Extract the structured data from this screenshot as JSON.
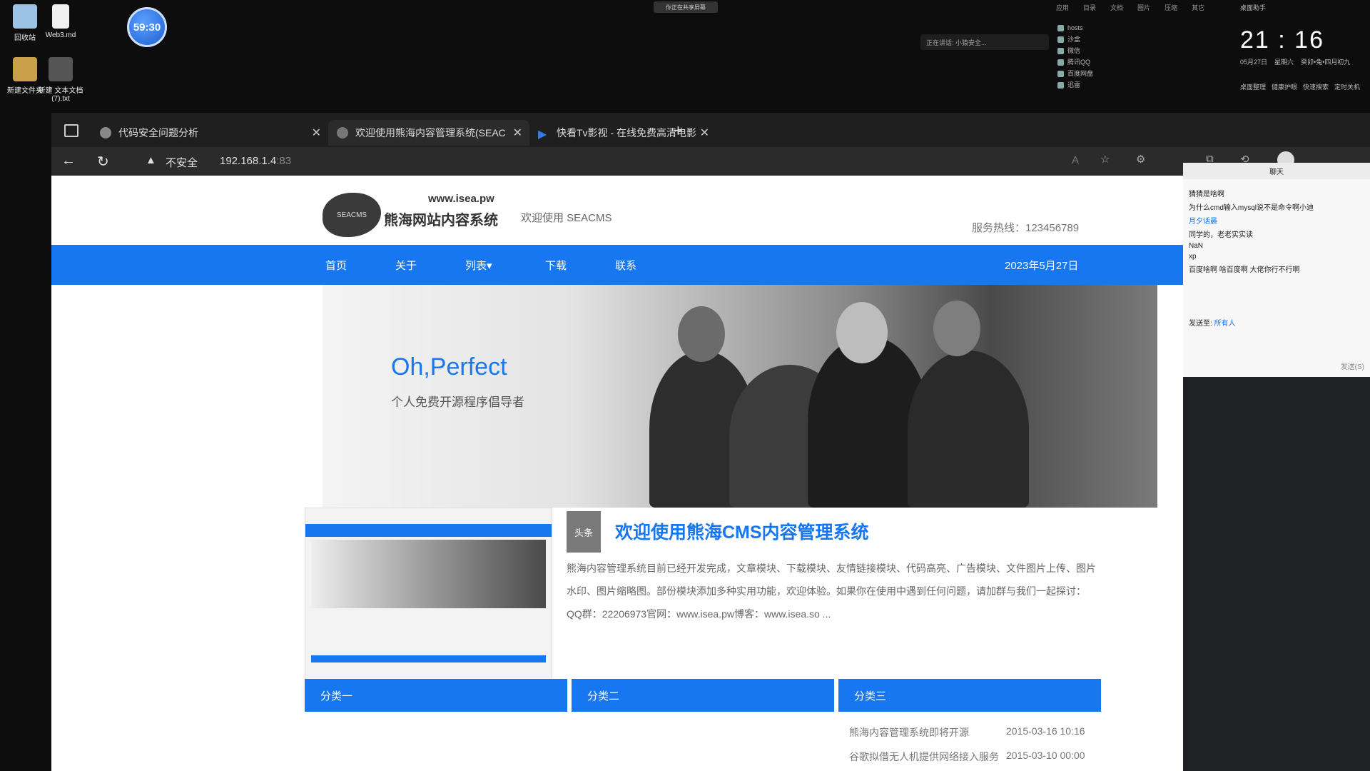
{
  "desktop": {
    "icons": [
      {
        "label": "回收站"
      },
      {
        "label": "Web3.md"
      },
      {
        "label": "新建文件夹"
      },
      {
        "label": "新建 文本文档 (7).txt"
      }
    ],
    "timer": "59:30",
    "top_pill": "你正在共享屏幕",
    "mini_bar": "正在讲话: 小猿安全..."
  },
  "fence": {
    "header": [
      "应用",
      "目录",
      "文档",
      "图片",
      "压缩",
      "其它"
    ],
    "items": [
      "hosts",
      "沙盒",
      "微信",
      "腾讯QQ",
      "百度网盘",
      "迅雷"
    ]
  },
  "clock_panel": {
    "title": "桌面助手",
    "time": "21 : 16",
    "date": "05月27日",
    "weekday": "星期六",
    "lunar": "癸卯•兔•四月初九",
    "actions": [
      "桌面整理",
      "健康护眼",
      "快速搜索",
      "定时关机"
    ]
  },
  "browser": {
    "tabs": [
      {
        "title": "代码安全问题分析"
      },
      {
        "title": "欢迎使用熊海内容管理系统(SEAC"
      },
      {
        "title": "快看Tv影视 - 在线免费高清电影"
      }
    ],
    "not_secure": "不安全",
    "url_host": "192.168.1.4",
    "url_port": ":83"
  },
  "chat": {
    "title": "聊天",
    "messages": [
      "猜猜是啥啊",
      "为什么cmd输入mysql说不是命令啊小迪",
      "月夕话晨",
      "同学的，老老实实读",
      "NaN",
      "xp",
      "百度啥啊 啥百度啊 大佬你行不行啊"
    ],
    "send_to_label": "发送至:",
    "send_to_value": "所有人",
    "send_button": "发送(S)"
  },
  "site": {
    "domain": "www.isea.pw",
    "logo_name": "熊海网站内容系统",
    "logo_badge": "SEACMS",
    "welcome": "欢迎使用 SEACMS",
    "hotline": "服务热线：123456789",
    "nav": [
      "首页",
      "关于",
      "列表",
      "下载",
      "联系"
    ],
    "nav_dropdown": "▾",
    "date": "2023年5月27日",
    "hero_title": "Oh,Perfect",
    "hero_sub": "个人免费开源程序倡导者",
    "article_tag": "头条",
    "article_title": "欢迎使用熊海CMS内容管理系统",
    "article_line1": "熊海内容管理系统目前已经开发完成，文章模块、下载模块、友情链接模块、代码高亮、广告模块、文件图片上传、图片",
    "article_line2": "水印、图片缩略图。部份模块添加多种实用功能，欢迎体验。如果你在使用中遇到任何问题，请加群与我们一起探讨：",
    "article_line3": "QQ群：22206973官网：www.isea.pw博客：www.isea.so ...",
    "categories": [
      "分类一",
      "分类二",
      "分类三"
    ],
    "news": [
      {
        "title": "熊海内容管理系统即将开源",
        "date": "2015-03-16 10:16"
      },
      {
        "title": "谷歌拟借无人机提供网络接入服务",
        "date": "2015-03-10 00:00"
      }
    ]
  }
}
